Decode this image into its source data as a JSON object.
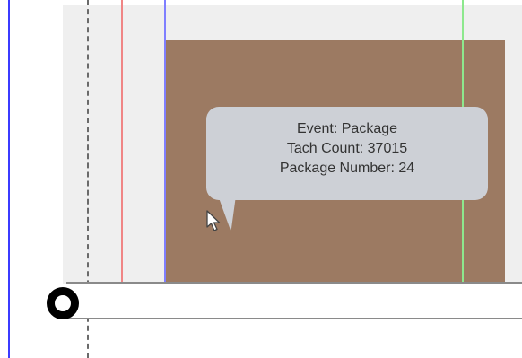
{
  "tooltip": {
    "event_line": "Event: Package",
    "tach_line": "Tach Count: 37015",
    "package_line": "Package Number: 24"
  },
  "colors": {
    "package_block": "#9c7a62",
    "tooltip_bg": "#cdd0d6",
    "red_marker": "#f08585",
    "blue_marker": "#7f7fff",
    "green_marker": "#8de88d",
    "left_axis": "#3b3bff"
  },
  "icons": {
    "cursor": "mouse-pointer-icon",
    "track_marker": "ring-marker-icon"
  }
}
